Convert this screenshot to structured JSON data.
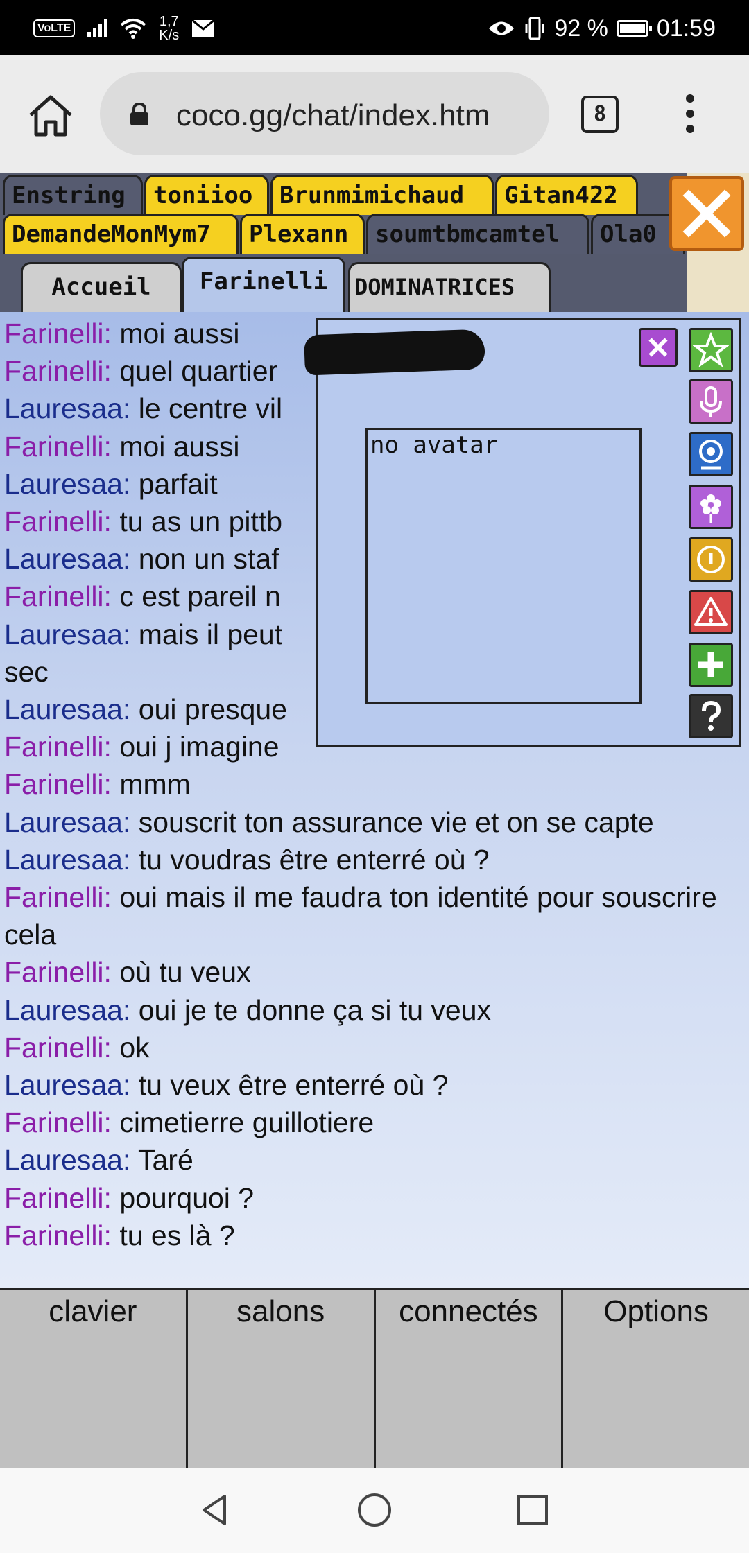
{
  "status_bar": {
    "volte": "VoLTE",
    "speed_value": "1,7",
    "speed_unit": "K/s",
    "battery": "92 %",
    "time": "01:59"
  },
  "browser": {
    "url": "coco.gg/chat/index.htm",
    "tab_count": "8"
  },
  "private_tabs": [
    "Enstring",
    "toniioo",
    "Brunmimichaud",
    "Gitan422",
    "DemandeMonMym7",
    "Plexann",
    "soumtbmcamtel",
    "Ola0"
  ],
  "room_tabs": [
    "Accueil",
    "Farinelli",
    "DOMINATRICES"
  ],
  "messages": [
    {
      "nick": "Farinelli:",
      "text": " moi aussi",
      "color": "#8a1ea8"
    },
    {
      "nick": "Farinelli:",
      "text": " quel quartier",
      "color": "#8a1ea8"
    },
    {
      "nick": "Lauresaa:",
      "text": " le centre vil",
      "color": "#1a2d8c"
    },
    {
      "nick": "Farinelli:",
      "text": " moi aussi",
      "color": "#8a1ea8"
    },
    {
      "nick": "Lauresaa:",
      "text": " parfait",
      "color": "#1a2d8c"
    },
    {
      "nick": "Farinelli:",
      "text": " tu as un pittb",
      "color": "#8a1ea8"
    },
    {
      "nick": "Lauresaa:",
      "text": " non un staf",
      "color": "#1a2d8c"
    },
    {
      "nick": "Farinelli:",
      "text": " c est pareil n",
      "color": "#8a1ea8"
    },
    {
      "nick": "Lauresaa:",
      "text": " mais il peut",
      "color": "#1a2d8c"
    },
    {
      "nick": "",
      "text": "sec",
      "color": "#1a2d8c"
    },
    {
      "nick": "Lauresaa:",
      "text": " oui presque",
      "color": "#1a2d8c"
    },
    {
      "nick": "Farinelli:",
      "text": " oui j imagine",
      "color": "#8a1ea8"
    },
    {
      "nick": "Farinelli:",
      "text": " mmm",
      "color": "#8a1ea8"
    },
    {
      "nick": "Lauresaa:",
      "text": " souscrit ton assurance vie et on se capte",
      "color": "#1a2d8c"
    },
    {
      "nick": "Lauresaa:",
      "text": " tu voudras être enterré où ?",
      "color": "#1a2d8c"
    },
    {
      "nick": "Farinelli:",
      "text": " oui mais il me faudra ton identité pour souscrire cela",
      "color": "#8a1ea8"
    },
    {
      "nick": "Farinelli:",
      "text": " où tu veux",
      "color": "#8a1ea8"
    },
    {
      "nick": "Lauresaa:",
      "text": " oui je te donne ça si tu veux",
      "color": "#1a2d8c"
    },
    {
      "nick": "Farinelli:",
      "text": " ok",
      "color": "#8a1ea8"
    },
    {
      "nick": "Lauresaa:",
      "text": " tu veux être enterré où ?",
      "color": "#1a2d8c"
    },
    {
      "nick": "Farinelli:",
      "text": " cimetierre guillotiere",
      "color": "#8a1ea8"
    },
    {
      "nick": "Lauresaa:",
      "text": " Taré",
      "color": "#1a2d8c"
    },
    {
      "nick": "Farinelli:",
      "text": " pourquoi ?",
      "color": "#8a1ea8"
    },
    {
      "nick": "Farinelli:",
      "text": " tu es là ?",
      "color": "#8a1ea8"
    }
  ],
  "profile_popup": {
    "avatar_text": "no avatar",
    "actions": [
      "close-icon",
      "star-icon",
      "microphone-icon",
      "webcam-icon",
      "flower-icon",
      "info-icon",
      "warning-icon",
      "plus-icon",
      "help-icon"
    ]
  },
  "bottom_nav": [
    "clavier",
    "salons",
    "connectés",
    "Options"
  ]
}
